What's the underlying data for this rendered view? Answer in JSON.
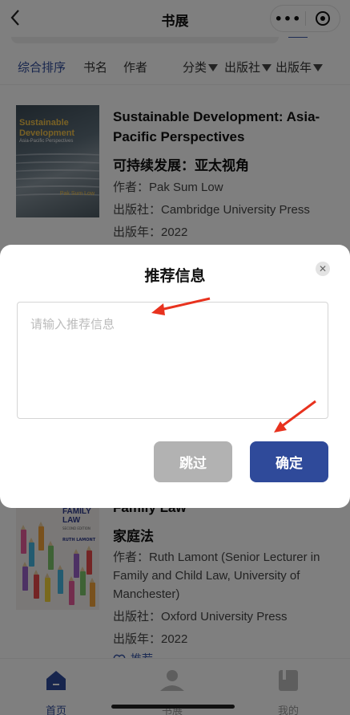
{
  "header": {
    "back_icon": "chevron-left-icon",
    "title": "书展",
    "more_label": "•••"
  },
  "sort_bar": {
    "items": [
      {
        "label": "综合排序",
        "active": true
      },
      {
        "label": "书名"
      },
      {
        "label": "作者"
      },
      {
        "label": "分类",
        "filter": true
      },
      {
        "label": "出版社",
        "filter": true
      },
      {
        "label": "出版年",
        "filter": true
      }
    ]
  },
  "books": [
    {
      "title_en": "Sustainable Development: Asia-Pacific Perspectives",
      "title_cn": "可持续发展：亚太视角",
      "author": "作者：Pak Sum Low",
      "publisher": "出版社：Cambridge University Press",
      "year": "出版年：2022",
      "cover": {
        "title": "Sustainable Development",
        "subtitle": "Asia-Pacific Perspectives",
        "author": "Pak Sum Low"
      }
    },
    {
      "title_en": "Family Law",
      "title_cn": "家庭法",
      "author": "作者：Ruth Lamont (Senior Lecturer in Family and Child Law, University of Manchester)",
      "publisher": "出版社：Oxford University Press",
      "year": "出版年：2022",
      "recommend_label": "推荐",
      "cover": {
        "title": "FAMILY LAW",
        "edition": "SECOND EDITION",
        "author": "RUTH LAMONT"
      }
    }
  ],
  "modal": {
    "title": "推荐信息",
    "input_placeholder": "请输入推荐信息",
    "input_value": "",
    "skip_label": "跳过",
    "confirm_label": "确定"
  },
  "tabbar": {
    "tabs": [
      {
        "label": "首页",
        "icon": "home-icon",
        "active": true
      },
      {
        "label": "书展",
        "icon": "user-icon"
      },
      {
        "label": "我的",
        "icon": "book-icon"
      }
    ]
  },
  "colors": {
    "accent": "#2f4a9a",
    "active_sort": "#2e4a9a",
    "annotation_arrow": "#e8321e",
    "skip_button": "#b2b2b2"
  }
}
